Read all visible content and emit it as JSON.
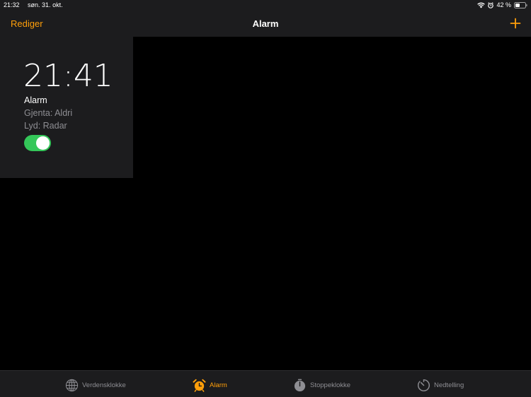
{
  "status_bar": {
    "time": "21:32",
    "date": "søn. 31. okt.",
    "battery": "42 %"
  },
  "nav": {
    "edit_label": "Rediger",
    "title": "Alarm"
  },
  "alarm": {
    "time": "21:41",
    "label": "Alarm",
    "repeat": "Gjenta: Aldri",
    "sound": "Lyd: Radar",
    "enabled": true
  },
  "tabs": [
    {
      "label": "Verdensklokke",
      "icon": "globe-icon",
      "active": false
    },
    {
      "label": "Alarm",
      "icon": "alarm-clock-icon",
      "active": true
    },
    {
      "label": "Stoppeklokke",
      "icon": "stopwatch-icon",
      "active": false
    },
    {
      "label": "Nedtelling",
      "icon": "timer-icon",
      "active": false
    }
  ],
  "colors": {
    "accent": "#ff9f0a",
    "toggle_on": "#34c759",
    "bar_background": "#1c1c1e",
    "secondary_text": "#8e8e93"
  }
}
